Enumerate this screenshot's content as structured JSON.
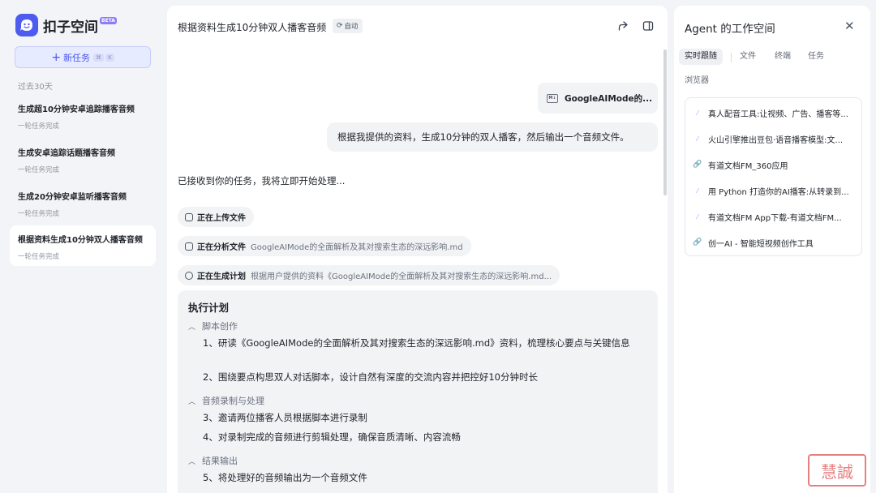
{
  "brand": {
    "name": "扣子空间",
    "badge": "BETA"
  },
  "sidebar": {
    "new_task_label": "新任务",
    "shortcut_keys": [
      "⌘",
      "K"
    ],
    "section_label": "过去30天",
    "history": [
      {
        "title": "生成超10分钟安卓追踪播客音频",
        "status": "一轮任务完成"
      },
      {
        "title": "生成安卓追踪话题播客音频",
        "status": "一轮任务完成"
      },
      {
        "title": "生成20分钟安卓监听播客音频",
        "status": "一轮任务完成"
      },
      {
        "title": "根据资料生成10分钟双人播客音频",
        "status": "一轮任务完成"
      }
    ]
  },
  "main": {
    "title": "根据资料生成10分钟双人播客音频",
    "auto_badge": "自动",
    "attachment": {
      "name": "GoogleAIMode的...",
      "icon": "markdown-file-icon"
    },
    "user_message": "根据我提供的资料，生成10分钟的双人播客，然后输出一个音频文件。",
    "ack": "已接收到你的任务，我将立即开始处理...",
    "steps": [
      {
        "label": "正在上传文件",
        "detail": ""
      },
      {
        "label": "正在分析文件",
        "detail": "GoogleAIMode的全面解析及其对搜索生态的深远影响.md"
      },
      {
        "label": "正在生成计划",
        "detail": "根据用户提供的资料《GoogleAIMode的全面解析及其对搜索生态的深远影响.md..."
      }
    ],
    "plan": {
      "title": "执行计划",
      "sections": [
        {
          "name": "脚本创作",
          "items": [
            "1、研读《GoogleAIMode的全面解析及其对搜索生态的深远影响.md》资料，梳理核心要点与关键信息",
            "2、围绕要点构思双人对话脚本，设计自然有深度的交流内容并把控好10分钟时长"
          ]
        },
        {
          "name": "音频录制与处理",
          "items": [
            "3、邀请两位播客人员根据脚本进行录制",
            "4、对录制完成的音频进行剪辑处理，确保音质清晰、内容流畅"
          ]
        },
        {
          "name": "结果输出",
          "items": [
            "5、将处理好的音频输出为一个音频文件"
          ]
        }
      ]
    }
  },
  "panel": {
    "title": "Agent 的工作空间",
    "tabs": [
      "实时跟随",
      "文件",
      "终端",
      "任务",
      "浏览器"
    ],
    "active_tab": "实时跟随",
    "links": [
      {
        "text": "真人配音工具:让视频、广告、播客等...",
        "icon": "dot-icon"
      },
      {
        "text": "火山引擎推出豆包·语音播客模型:文...",
        "icon": "dot-icon"
      },
      {
        "text": "有道文档FM_360应用",
        "icon": "link-icon"
      },
      {
        "text": "用 Python 打造你的AI播客:从转录到...",
        "icon": "dot-icon"
      },
      {
        "text": "有道文档FM App下载-有道文档FM...",
        "icon": "dot-icon"
      },
      {
        "text": "创一AI - 智能短视频创作工具",
        "icon": "link-icon"
      }
    ]
  },
  "colors": {
    "accent": "#4e5bf0",
    "link": "#4d6bfe"
  },
  "watermark": "慧誠"
}
